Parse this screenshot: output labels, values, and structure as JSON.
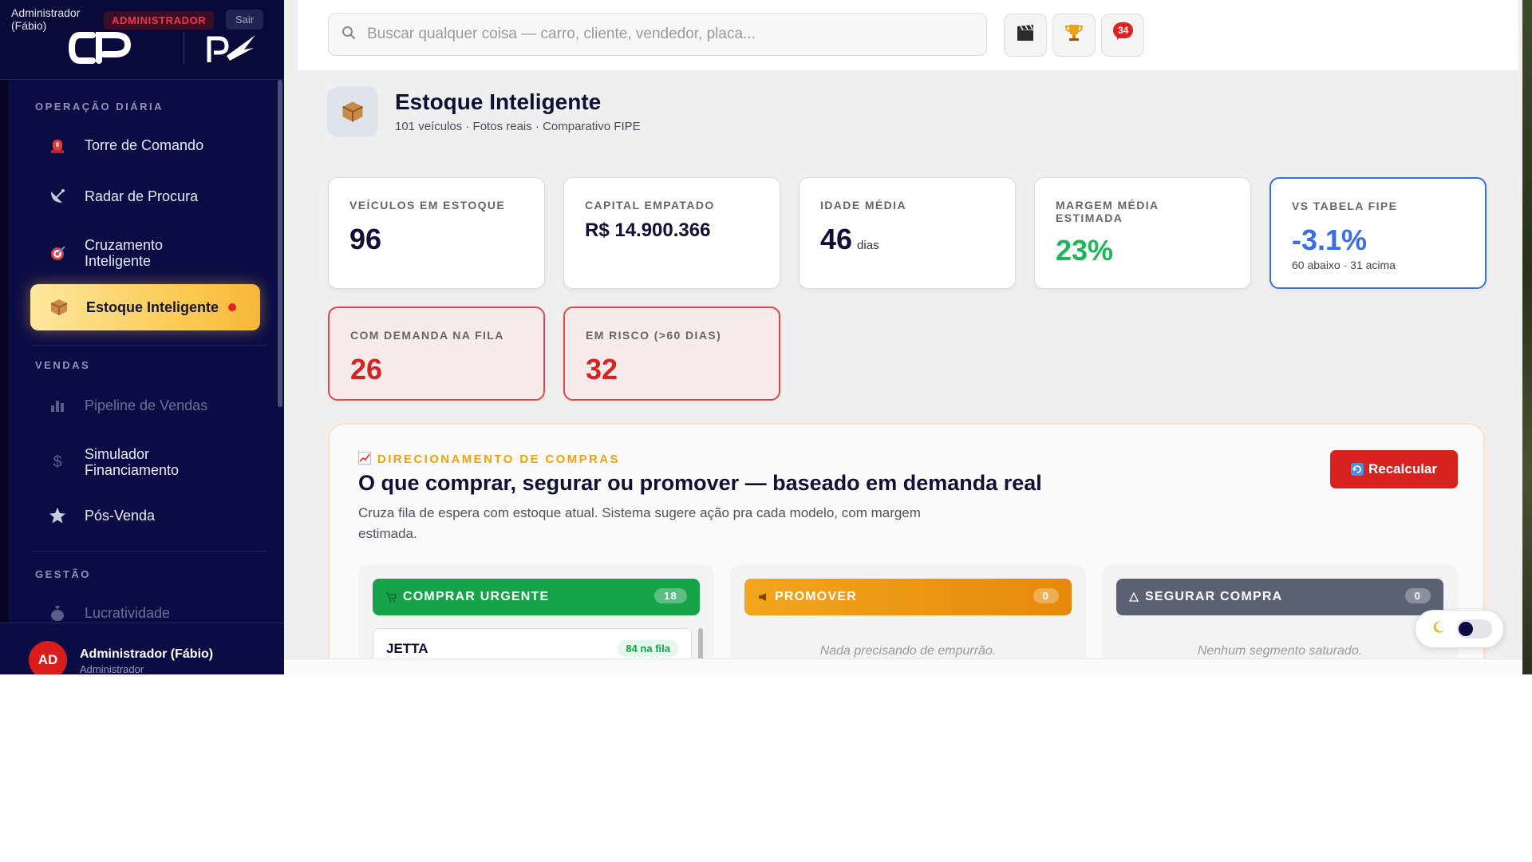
{
  "sidebar": {
    "admin_name": "Administrador (Fábio)",
    "role_badge": "ADMINISTRADOR",
    "logout_label": "Sair",
    "sections": {
      "daily": "OPERAÇÃO DIÁRIA",
      "sales": "VENDAS",
      "management": "GESTÃO"
    },
    "items": [
      {
        "label": "Torre de Comando",
        "icon": "siren-icon"
      },
      {
        "label": "Radar de Procura",
        "icon": "satellite-dish-icon"
      },
      {
        "label": "Cruzamento Inteligente",
        "icon": "target-icon"
      },
      {
        "label": "Estoque Inteligente",
        "icon": "package-icon"
      },
      {
        "label": "Pipeline de Vendas",
        "icon": "bar-chart-icon"
      },
      {
        "label": "Simulador Financiamento",
        "icon": "dollar-icon"
      },
      {
        "label": "Pós-Venda",
        "icon": "star-icon"
      },
      {
        "label": "Lucratividade",
        "icon": "money-bag-icon"
      }
    ],
    "user": {
      "initials": "AD",
      "name": "Administrador (Fábio)",
      "role": "Administrador"
    }
  },
  "topbar": {
    "search_placeholder": "Buscar qualquer coisa — carro, cliente, vendedor, placa...",
    "notification_count": "34",
    "buttons": [
      "clapperboard-icon",
      "trophy-icon",
      "notification-icon"
    ]
  },
  "page": {
    "title": "Estoque Inteligente",
    "subtitle": "101 veículos · Fotos reais · Comparativo FIPE"
  },
  "kpis": [
    {
      "label": "VEÍCULOS EM ESTOQUE",
      "value": "96"
    },
    {
      "label": "CAPITAL EMPATADO",
      "value": "R$ 14.900.366"
    },
    {
      "label": "IDADE MÉDIA",
      "value": "46",
      "unit": "dias"
    },
    {
      "label": "MARGEM MÉDIA ESTIMADA",
      "value": "23%"
    },
    {
      "label": "VS TABELA FIPE",
      "value": "-3.1%",
      "note": "60 abaixo · 31 acima"
    },
    {
      "label": "COM DEMANDA NA FILA",
      "value": "26"
    },
    {
      "label": "EM RISCO (>60 DIAS)",
      "value": "32"
    }
  ],
  "panel": {
    "kicker": "DIRECIONAMENTO DE COMPRAS",
    "title": "O que comprar, segurar ou promover — baseado em demanda real",
    "description": "Cruza fila de espera com estoque atual. Sistema sugere ação pra cada modelo, com margem estimada.",
    "recalc_label": "Recalcular",
    "columns": [
      {
        "label": "COMPRAR URGENTE",
        "count": "18",
        "items": [
          {
            "name": "JETTA",
            "tag": "84 na fila"
          }
        ]
      },
      {
        "label": "PROMOVER",
        "count": "0",
        "empty": "Nada precisando de empurrão."
      },
      {
        "label": "SEGURAR COMPRA",
        "count": "0",
        "empty": "Nenhum segmento saturado."
      }
    ]
  },
  "colors": {
    "sidebar_bg": "#0c0c45",
    "accent_gold": "#fbc84e",
    "danger": "#d8221f",
    "success": "#1fb65a",
    "fipe_blue": "#3b6fe0",
    "urgent_green": "#16a34a",
    "promote_orange": "#f59e0b",
    "hold_gray": "#5b6173"
  }
}
